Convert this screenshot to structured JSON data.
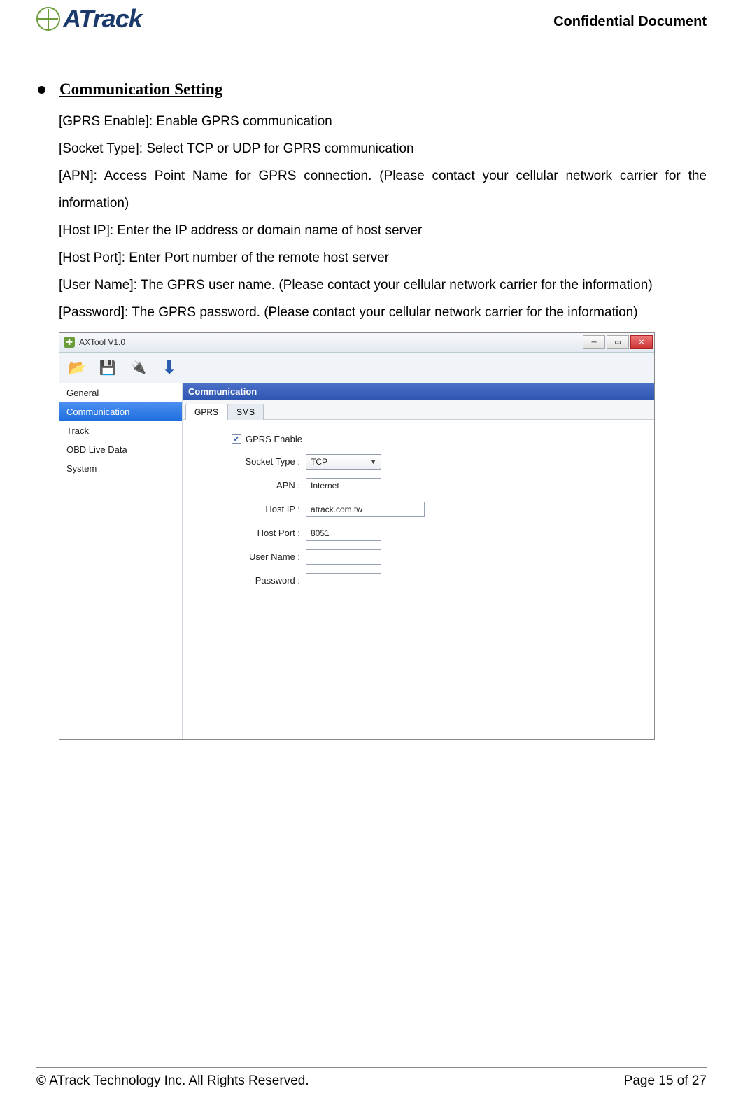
{
  "header": {
    "logo_text": "ATrack",
    "confidential": "Confidential  Document"
  },
  "section": {
    "title": "Communication Setting",
    "descriptions": [
      "[GPRS Enable]: Enable GPRS communication",
      "[Socket Type]: Select TCP or UDP for GPRS communication",
      "[APN]: Access Point Name for GPRS connection. (Please contact your cellular network carrier for the information)",
      "[Host IP]: Enter the IP address or domain name of host server",
      "[Host Port]: Enter Port number of the remote host server",
      "[User Name]: The GPRS user name. (Please contact your cellular network carrier for the information)",
      "[Password]: The GPRS password. (Please contact your cellular network carrier for the information)"
    ]
  },
  "app": {
    "title": "AXTool V1.0",
    "sidebar": {
      "items": [
        "General",
        "Communication",
        "Track",
        "OBD Live Data",
        "System"
      ],
      "selected_index": 1
    },
    "panel": {
      "header": "Communication",
      "tabs": [
        "GPRS",
        "SMS"
      ],
      "active_tab_index": 0,
      "gprs": {
        "enable_label": "GPRS Enable",
        "enable_checked": true,
        "fields": {
          "socket_type": {
            "label": "Socket Type :",
            "value": "TCP"
          },
          "apn": {
            "label": "APN :",
            "value": "Internet"
          },
          "host_ip": {
            "label": "Host IP :",
            "value": "atrack.com.tw"
          },
          "host_port": {
            "label": "Host Port :",
            "value": "8051"
          },
          "user_name": {
            "label": "User Name :",
            "value": ""
          },
          "password": {
            "label": "Password :",
            "value": ""
          }
        }
      }
    }
  },
  "footer": {
    "copyright": "© ATrack Technology Inc. All Rights Reserved.",
    "page": "Page 15 of 27"
  }
}
